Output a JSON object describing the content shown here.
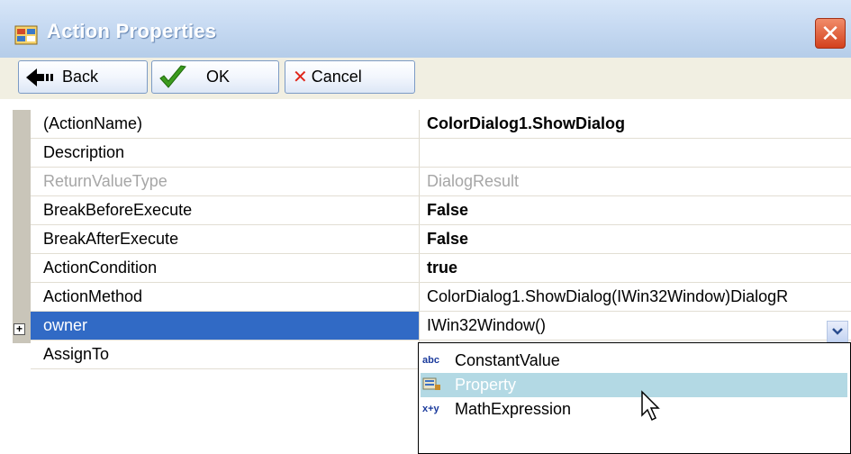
{
  "window": {
    "title": "Action Properties",
    "close_glyph": "✕"
  },
  "toolbar": {
    "back_label": "Back",
    "ok_label": "OK",
    "cancel_label": "Cancel"
  },
  "properties": [
    {
      "name": "(ActionName)",
      "value": "ColorDialog1.ShowDialog",
      "bold": true
    },
    {
      "name": "Description",
      "value": ""
    },
    {
      "name": "ReturnValueType",
      "value": "DialogResult",
      "disabled": true
    },
    {
      "name": "BreakBeforeExecute",
      "value": "False",
      "bold": true
    },
    {
      "name": "BreakAfterExecute",
      "value": "False",
      "bold": true
    },
    {
      "name": "ActionCondition",
      "value": "true",
      "bold": true
    },
    {
      "name": "ActionMethod",
      "value": "ColorDialog1.ShowDialog(IWin32Window)DialogR"
    },
    {
      "name": "owner",
      "value": "IWin32Window()",
      "selected": true,
      "expandable": true
    },
    {
      "name": "AssignTo",
      "value": ""
    }
  ],
  "dropdown": {
    "items": [
      {
        "icon": "abc",
        "label": "ConstantValue"
      },
      {
        "icon": "property-icon",
        "label": "Property",
        "highlighted": true
      },
      {
        "icon": "x+y",
        "label": "MathExpression"
      }
    ]
  },
  "colors": {
    "titlebar": "#c7daf2",
    "selection": "#316ac5",
    "dropdown_highlight": "#b3d9e4",
    "toolbar": "#f1efe2",
    "gutter": "#c9c5b9"
  }
}
